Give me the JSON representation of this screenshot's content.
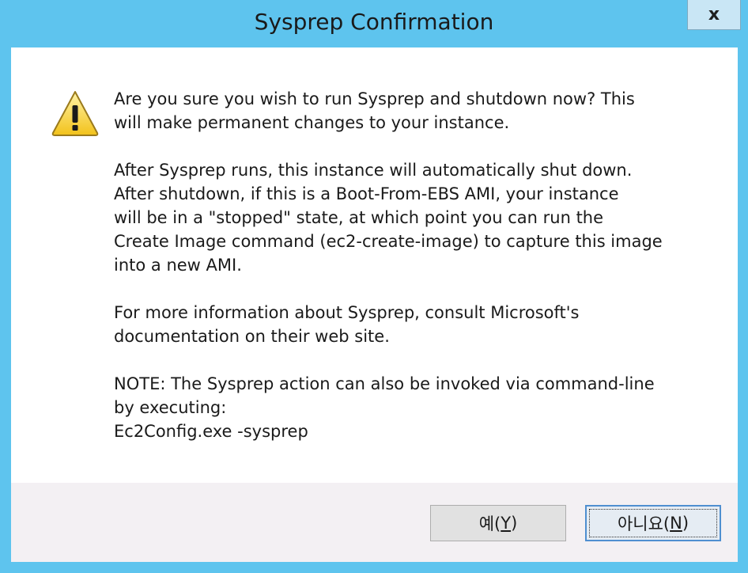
{
  "window": {
    "title": "Sysprep Confirmation",
    "close_label": "x"
  },
  "icon": "warning-icon",
  "message": {
    "p1": "Are you sure you wish to run Sysprep and shutdown now?  This\nwill make permanent changes to your instance.",
    "p2": "After Sysprep runs, this instance will automatically shut down.\nAfter shutdown, if this is a Boot-From-EBS AMI, your instance\nwill be in a \"stopped\" state, at which point you can run the\nCreate Image command (ec2-create-image) to capture this image\ninto a new AMI.",
    "p3": "For more information about Sysprep, consult Microsoft's\ndocumentation on their web site.",
    "p4": "NOTE: The Sysprep action can also be invoked via command-line\nby executing:\nEc2Config.exe -sysprep"
  },
  "buttons": {
    "yes": {
      "prefix": "예(",
      "mnemonic": "Y",
      "suffix": ")"
    },
    "no": {
      "prefix": "아니요(",
      "mnemonic": "N",
      "suffix": ")"
    }
  },
  "colors": {
    "frame": "#5ec4ee",
    "footer": "#f3f0f3",
    "default_button_border": "#4f8fd0"
  }
}
